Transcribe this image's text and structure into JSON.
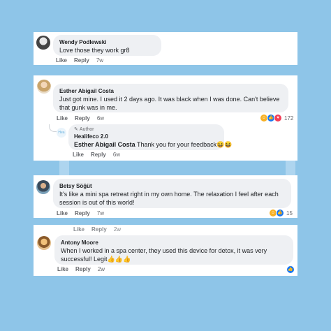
{
  "colors": {
    "background": "#8ec5e8",
    "bubble": "#eef0f3",
    "like_blue": "#1877f2",
    "love_red": "#f33e58",
    "haha_yellow": "#f7b125"
  },
  "comments": [
    {
      "name": "Wendy Podlewski",
      "text": "Love those they work gr8",
      "like": "Like",
      "reply": "Reply",
      "time": "7w"
    },
    {
      "name": "Esther Abigail Costa",
      "text": "Just got mine. I used it 2 days ago. It was black when I was done. Can't believe that gunk was in me.",
      "like": "Like",
      "reply": "Reply",
      "time": "6w",
      "reaction_count": "172",
      "reply_item": {
        "avatar_text": "Hea",
        "author_badge": "Author",
        "name": "Healifeco 2.0",
        "mention": "Esther Abigail Costa",
        "text": "Thank you for your feedback😆😆",
        "like": "Like",
        "reply": "Reply",
        "time": "6w"
      }
    },
    {
      "name": "Betsy Söğüt",
      "text": "It's like a mini spa retreat right in my own home. The relaxation I feel after each session is out of this world!",
      "like": "Like",
      "reply": "Reply",
      "time": "7w",
      "reaction_count": "15"
    },
    {
      "prev_like": "Like",
      "prev_reply": "Reply",
      "prev_time": "2w",
      "name": "Antony Moore",
      "text": "When I worked in a spa center, they used this device for detox, it was very successful! Legit👍👍👍",
      "like": "Like",
      "reply": "Reply",
      "time": "2w"
    }
  ]
}
